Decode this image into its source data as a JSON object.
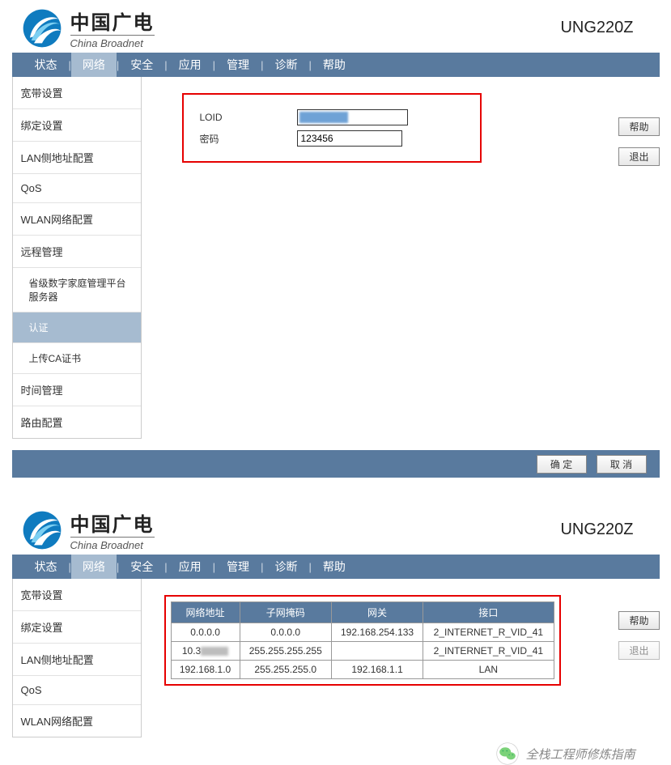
{
  "brand": {
    "cn": "中国广电",
    "en": "China Broadnet"
  },
  "model": "UNG220Z",
  "nav": {
    "items": [
      "状态",
      "网络",
      "安全",
      "应用",
      "管理",
      "诊断",
      "帮助"
    ],
    "active_index": 1
  },
  "sidebar1": {
    "items": [
      {
        "label": "宽带设置"
      },
      {
        "label": "绑定设置"
      },
      {
        "label": "LAN侧地址配置"
      },
      {
        "label": "QoS"
      },
      {
        "label": "WLAN网络配置"
      },
      {
        "label": "远程管理",
        "children": [
          {
            "label": "省级数字家庭管理平台服务器"
          },
          {
            "label": "认证",
            "active": true
          },
          {
            "label": "上传CA证书"
          }
        ]
      },
      {
        "label": "时间管理"
      },
      {
        "label": "路由配置"
      }
    ]
  },
  "form1": {
    "loid_label": "LOID",
    "loid_value": "",
    "pwd_label": "密码",
    "pwd_value": "123456"
  },
  "right_buttons": {
    "help": "帮助",
    "logout": "退出"
  },
  "footer_buttons": {
    "ok": "确 定",
    "cancel": "取 消"
  },
  "sidebar2": {
    "items": [
      {
        "label": "宽带设置"
      },
      {
        "label": "绑定设置"
      },
      {
        "label": "LAN侧地址配置"
      },
      {
        "label": "QoS"
      },
      {
        "label": "WLAN网络配置"
      }
    ]
  },
  "table": {
    "headers": [
      "网络地址",
      "子网掩码",
      "网关",
      "接口"
    ],
    "rows": [
      [
        "0.0.0.0",
        "0.0.0.0",
        "192.168.254.133",
        "2_INTERNET_R_VID_41"
      ],
      [
        "10.3■■■",
        "255.255.255.255",
        "",
        "2_INTERNET_R_VID_41"
      ],
      [
        "192.168.1.0",
        "255.255.255.0",
        "192.168.1.1",
        "LAN"
      ]
    ]
  },
  "wechat_caption": "全栈工程师修炼指南"
}
